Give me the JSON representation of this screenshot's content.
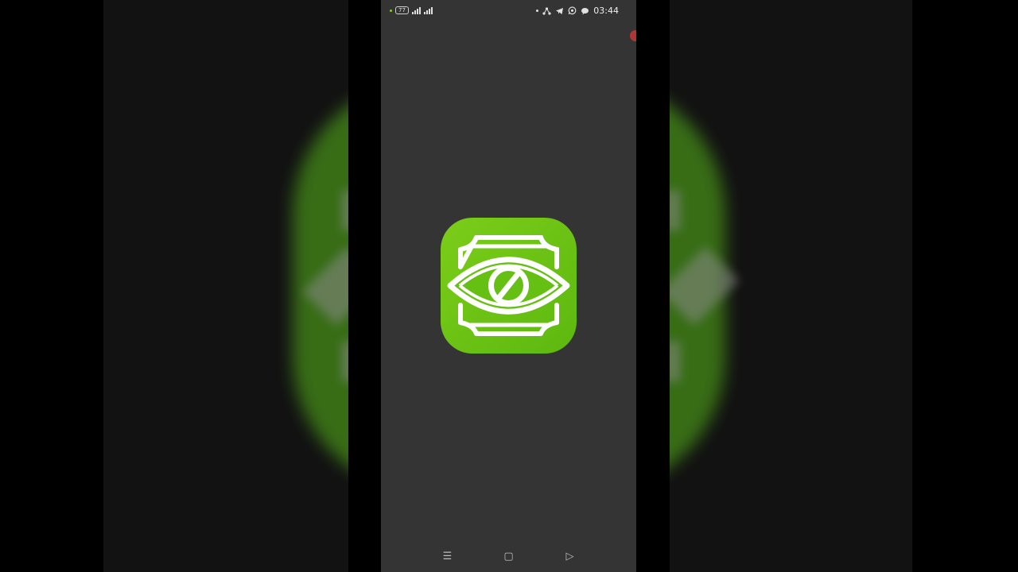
{
  "status_bar": {
    "battery_level": "77",
    "signal_1": "signal-bars-icon",
    "signal_2": "signal-bars-icon",
    "notification_icons": [
      "dot-icon",
      "share-icon",
      "telegram-icon",
      "whatsapp-icon",
      "chat-bubble-icon"
    ],
    "time": "03:44"
  },
  "app": {
    "icon": "eye-block-icon",
    "icon_color": "#6cc314"
  },
  "nav_bar": {
    "menu_icon": "☰",
    "home_icon": "▢",
    "back_icon": "▷"
  },
  "colors": {
    "screen_bg": "#343434",
    "letterbox_bg": "#000000",
    "accent_green": "#6cc314",
    "notification_dot": "#b03636"
  }
}
